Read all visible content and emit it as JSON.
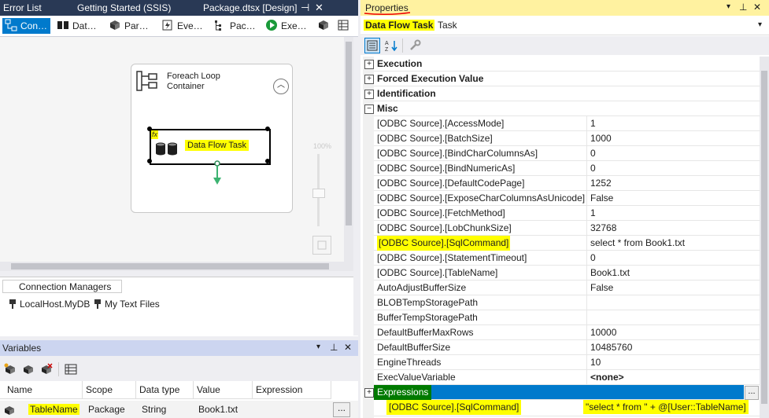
{
  "doc_tabs": {
    "error_list": "Error List",
    "getting_started": "Getting Started (SSIS)",
    "package": "Package.dtsx [Design]"
  },
  "designer_toolbar": [
    {
      "label": "Con…",
      "icon": "control-flow-icon"
    },
    {
      "label": "Dat…",
      "icon": "data-flow-icon"
    },
    {
      "label": "Par…",
      "icon": "parameters-icon"
    },
    {
      "label": "Eve…",
      "icon": "event-handlers-icon"
    },
    {
      "label": "Pac…",
      "icon": "package-explorer-icon"
    },
    {
      "label": "Exe…",
      "icon": "execute-icon"
    }
  ],
  "canvas": {
    "container_title": "Foreach Loop Container",
    "task_label": "Data Flow Task",
    "fx_badge": "fx",
    "zoom_label": "100%"
  },
  "connection_managers": {
    "tab_label": "Connection Managers",
    "items": [
      "LocalHost.MyDB",
      "My Text Files"
    ]
  },
  "variables": {
    "title": "Variables",
    "columns": [
      "Name",
      "Scope",
      "Data type",
      "Value",
      "Expression"
    ],
    "rows": [
      {
        "name": "TableName",
        "scope": "Package",
        "type": "String",
        "value": "Book1.txt",
        "expression": ""
      }
    ],
    "ellipsis": "..."
  },
  "properties": {
    "title": "Properties",
    "object_name": "Data Flow Task",
    "object_type": "Task",
    "categories": [
      "Execution",
      "Forced Execution Value",
      "Identification",
      "Misc"
    ],
    "misc_rows": [
      {
        "name": "[ODBC Source].[AccessMode]",
        "value": "1"
      },
      {
        "name": "[ODBC Source].[BatchSize]",
        "value": "1000"
      },
      {
        "name": "[ODBC Source].[BindCharColumnsAs]",
        "value": "0"
      },
      {
        "name": "[ODBC Source].[BindNumericAs]",
        "value": "0"
      },
      {
        "name": "[ODBC Source].[DefaultCodePage]",
        "value": "1252"
      },
      {
        "name": "[ODBC Source].[ExposeCharColumnsAsUnicode]",
        "value": "False"
      },
      {
        "name": "[ODBC Source].[FetchMethod]",
        "value": "1"
      },
      {
        "name": "[ODBC Source].[LobChunkSize]",
        "value": "32768"
      },
      {
        "name": "[ODBC Source].[SqlCommand]",
        "value": "select * from Book1.txt"
      },
      {
        "name": "[ODBC Source].[StatementTimeout]",
        "value": "0"
      },
      {
        "name": "[ODBC Source].[TableName]",
        "value": "Book1.txt"
      },
      {
        "name": "AutoAdjustBufferSize",
        "value": "False"
      },
      {
        "name": "BLOBTempStoragePath",
        "value": ""
      },
      {
        "name": "BufferTempStoragePath",
        "value": ""
      },
      {
        "name": "DefaultBufferMaxRows",
        "value": "10000"
      },
      {
        "name": "DefaultBufferSize",
        "value": "10485760"
      },
      {
        "name": "EngineThreads",
        "value": "10"
      },
      {
        "name": "ExecValueVariable",
        "value": "<none>"
      }
    ],
    "expressions_label": "Expressions",
    "expression_row": {
      "name": "[ODBC Source].[SqlCommand]",
      "value": "\"select * from \" + @[User::TableName]"
    },
    "ellipsis": "..."
  },
  "colors": {
    "accent": "#007acc",
    "highlight": "#ffff00",
    "expressions_green": "#007a00",
    "tab_bar": "#293955"
  }
}
